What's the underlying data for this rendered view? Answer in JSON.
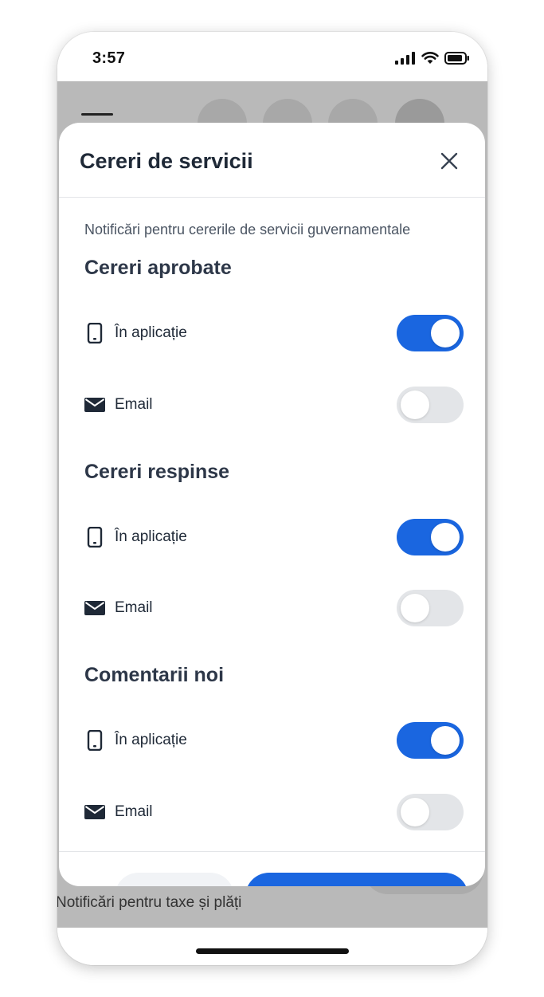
{
  "status_bar": {
    "time": "3:57"
  },
  "background": {
    "footer_text": "Notificări pentru taxe și plăți"
  },
  "sheet": {
    "title": "Cereri de servicii",
    "subtitle": "Notificări pentru cererile de servicii guvernamentale",
    "sections": [
      {
        "title": "Cereri aprobate",
        "options": [
          {
            "icon": "phone-icon",
            "label": "În aplicație",
            "enabled": true
          },
          {
            "icon": "envelope-icon",
            "label": "Email",
            "enabled": false
          }
        ]
      },
      {
        "title": "Cereri respinse",
        "options": [
          {
            "icon": "phone-icon",
            "label": "În aplicație",
            "enabled": true
          },
          {
            "icon": "envelope-icon",
            "label": "Email",
            "enabled": false
          }
        ]
      },
      {
        "title": "Comentarii noi",
        "options": [
          {
            "icon": "phone-icon",
            "label": "În aplicație",
            "enabled": true
          },
          {
            "icon": "envelope-icon",
            "label": "Email",
            "enabled": false
          }
        ]
      }
    ]
  },
  "colors": {
    "accent": "#1a66e0",
    "toggle_off": "#e3e5e8",
    "overlay": "#b9b9b9",
    "text_dark": "#1f2937"
  }
}
